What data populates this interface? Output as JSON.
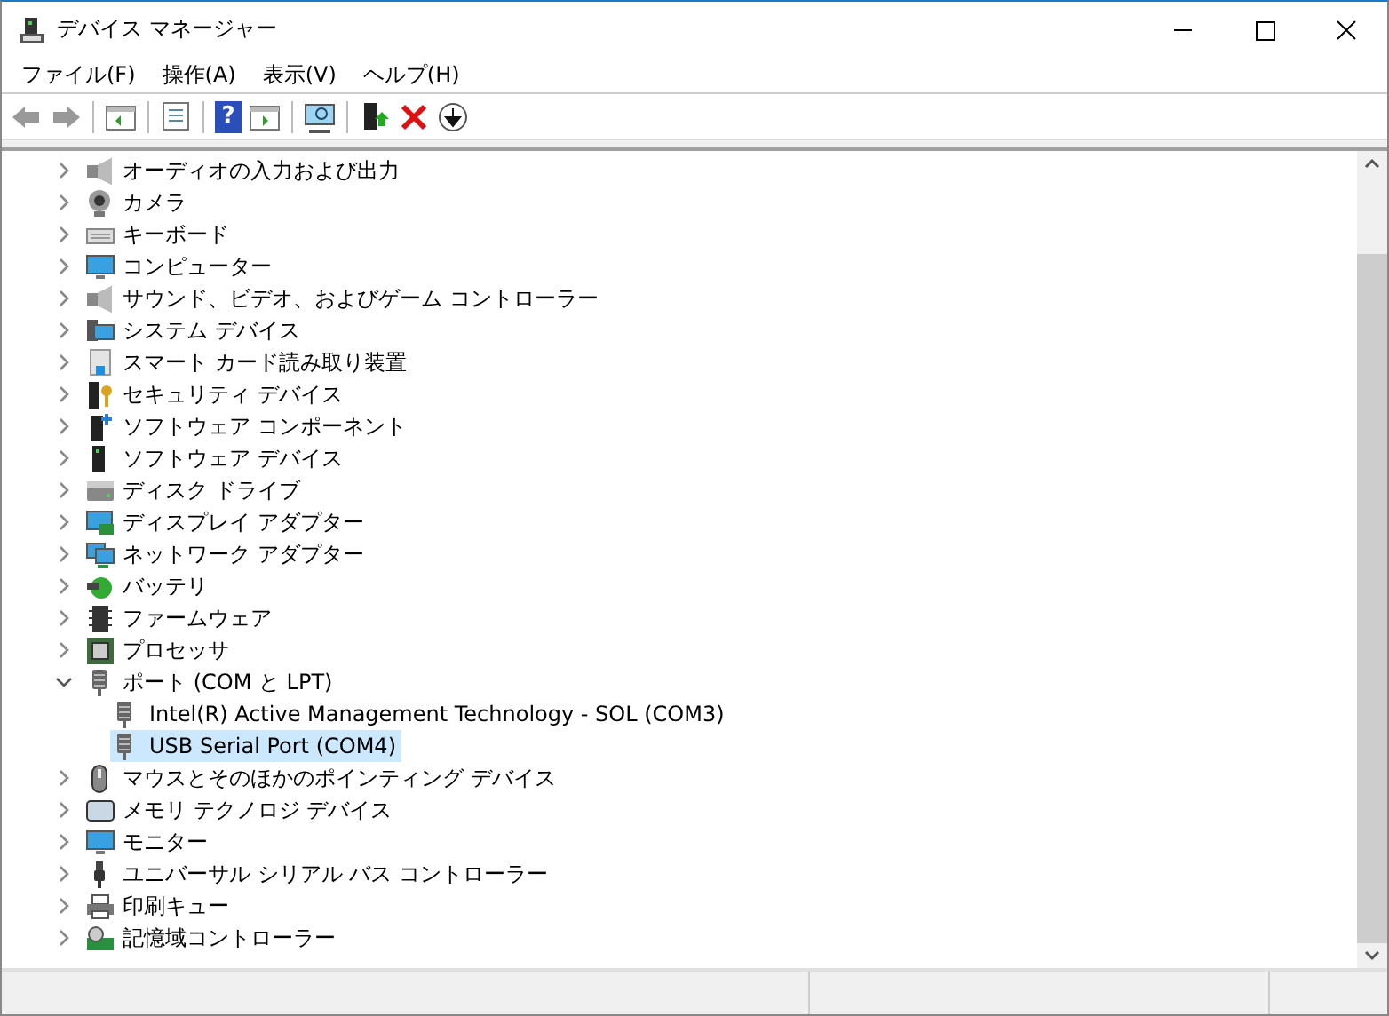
{
  "window": {
    "title": "デバイス マネージャー"
  },
  "toolbar": {
    "help_label": "?"
  },
  "menu": [
    {
      "label": "ファイル(F)"
    },
    {
      "label": "操作(A)"
    },
    {
      "label": "表示(V)"
    },
    {
      "label": "ヘルプ(H)"
    }
  ],
  "tree": [
    {
      "label": "オーディオの入力および出力",
      "expanded": false
    },
    {
      "label": "カメラ",
      "expanded": false
    },
    {
      "label": "キーボード",
      "expanded": false
    },
    {
      "label": "コンピューター",
      "expanded": false
    },
    {
      "label": "サウンド、ビデオ、およびゲーム コントローラー",
      "expanded": false
    },
    {
      "label": "システム デバイス",
      "expanded": false
    },
    {
      "label": "スマート カード読み取り装置",
      "expanded": false
    },
    {
      "label": "セキュリティ デバイス",
      "expanded": false
    },
    {
      "label": "ソフトウェア コンポーネント",
      "expanded": false
    },
    {
      "label": "ソフトウェア デバイス",
      "expanded": false
    },
    {
      "label": "ディスク ドライブ",
      "expanded": false
    },
    {
      "label": "ディスプレイ アダプター",
      "expanded": false
    },
    {
      "label": "ネットワーク アダプター",
      "expanded": false
    },
    {
      "label": "バッテリ",
      "expanded": false
    },
    {
      "label": "ファームウェア",
      "expanded": false
    },
    {
      "label": "プロセッサ",
      "expanded": false
    },
    {
      "label": "ポート (COM と LPT)",
      "expanded": true,
      "children": [
        {
          "label": "Intel(R) Active Management Technology - SOL (COM3)",
          "selected": false
        },
        {
          "label": "USB Serial Port (COM4)",
          "selected": true
        }
      ]
    },
    {
      "label": "マウスとそのほかのポインティング デバイス",
      "expanded": false
    },
    {
      "label": "メモリ テクノロジ デバイス",
      "expanded": false
    },
    {
      "label": "モニター",
      "expanded": false
    },
    {
      "label": "ユニバーサル シリアル バス コントローラー",
      "expanded": false
    },
    {
      "label": "印刷キュー",
      "expanded": false
    },
    {
      "label": "記憶域コントローラー",
      "expanded": false
    }
  ]
}
